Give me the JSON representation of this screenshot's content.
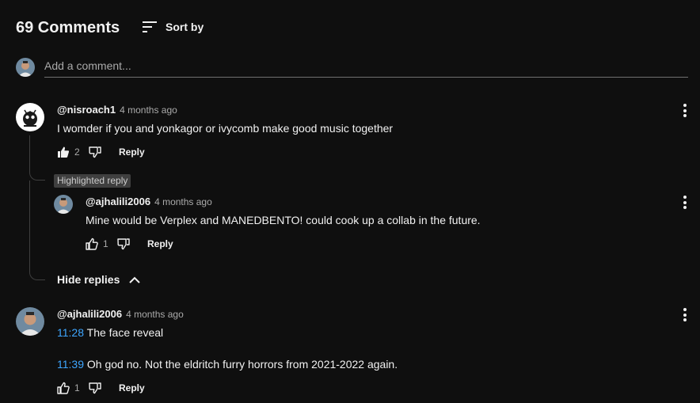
{
  "header": {
    "comment_count": "69 Comments",
    "sort_label": "Sort by",
    "sort_icon": "sort-icon"
  },
  "add_comment": {
    "placeholder": "Add a comment..."
  },
  "comments": [
    {
      "handle": "@nisroach1",
      "time": "4 months ago",
      "text": "I womder if you and yonkagor or ivycomb make good music together",
      "likes": "2",
      "reply_label": "Reply",
      "liked": true
    },
    {
      "badge": "Highlighted reply",
      "handle": "@ajhalili2006",
      "time": "4 months ago",
      "text": "Mine would be Verplex and MANEDBENTO! could cook up a collab in the future.",
      "likes": "1",
      "reply_label": "Reply"
    },
    {
      "handle": "@ajhalili2006",
      "time": "4 months ago",
      "lines": [
        {
          "timestamp": "11:28",
          "text": " The face reveal"
        },
        {
          "timestamp": "11:39",
          "text": " Oh god no. Not the eldritch furry horrors from 2021-2022 again."
        }
      ],
      "likes": "1",
      "reply_label": "Reply"
    }
  ],
  "hide_replies_label": "Hide replies",
  "colors": {
    "background": "#0f0f0f",
    "text": "#f1f1f1",
    "secondary_text": "#aaaaaa",
    "link": "#3ea6ff",
    "badge_bg": "#3f3f3f"
  }
}
